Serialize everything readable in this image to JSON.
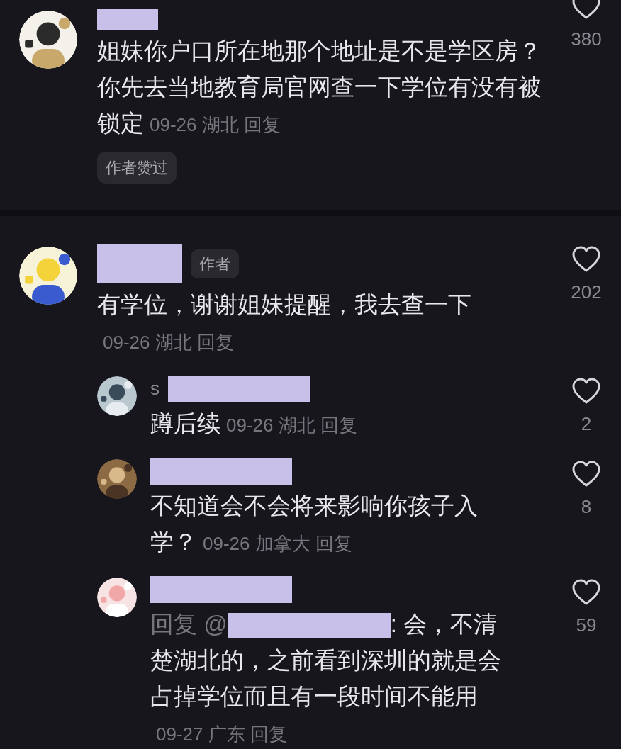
{
  "comments": [
    {
      "author": {
        "redacted": true
      },
      "text": "姐妹你户口所在地那个地址是不是学区房？你先去当地教育局官网查一下学位有没有被锁定",
      "meta": "09-26 湖北",
      "reply_link": "回复",
      "tag": "作者赞过",
      "likes": "380"
    },
    {
      "author": {
        "redacted": true
      },
      "badge": "作者",
      "text": "有学位，谢谢姐妹提醒，我去查一下",
      "meta": "09-26 湖北",
      "reply_link": "回复",
      "likes": "202",
      "replies": [
        {
          "author": {
            "redacted": true,
            "visible_prefix": "s"
          },
          "text": "蹲后续",
          "meta": "09-26 湖北",
          "reply_link": "回复",
          "likes": "2"
        },
        {
          "author": {
            "redacted": true
          },
          "text": "不知道会不会将来影响你孩子入学？",
          "meta": "09-26 加拿大",
          "reply_link": "回复",
          "likes": "8"
        },
        {
          "author": {
            "redacted": true
          },
          "reply_to": {
            "prefix": "回复 @",
            "redacted": true
          },
          "text": ": 会，不清楚湖北的，之前看到深圳的就是会占掉学位而且有一段时间不能用",
          "meta": "09-27 广东",
          "reply_link": "回复",
          "likes": "59"
        }
      ]
    }
  ]
}
